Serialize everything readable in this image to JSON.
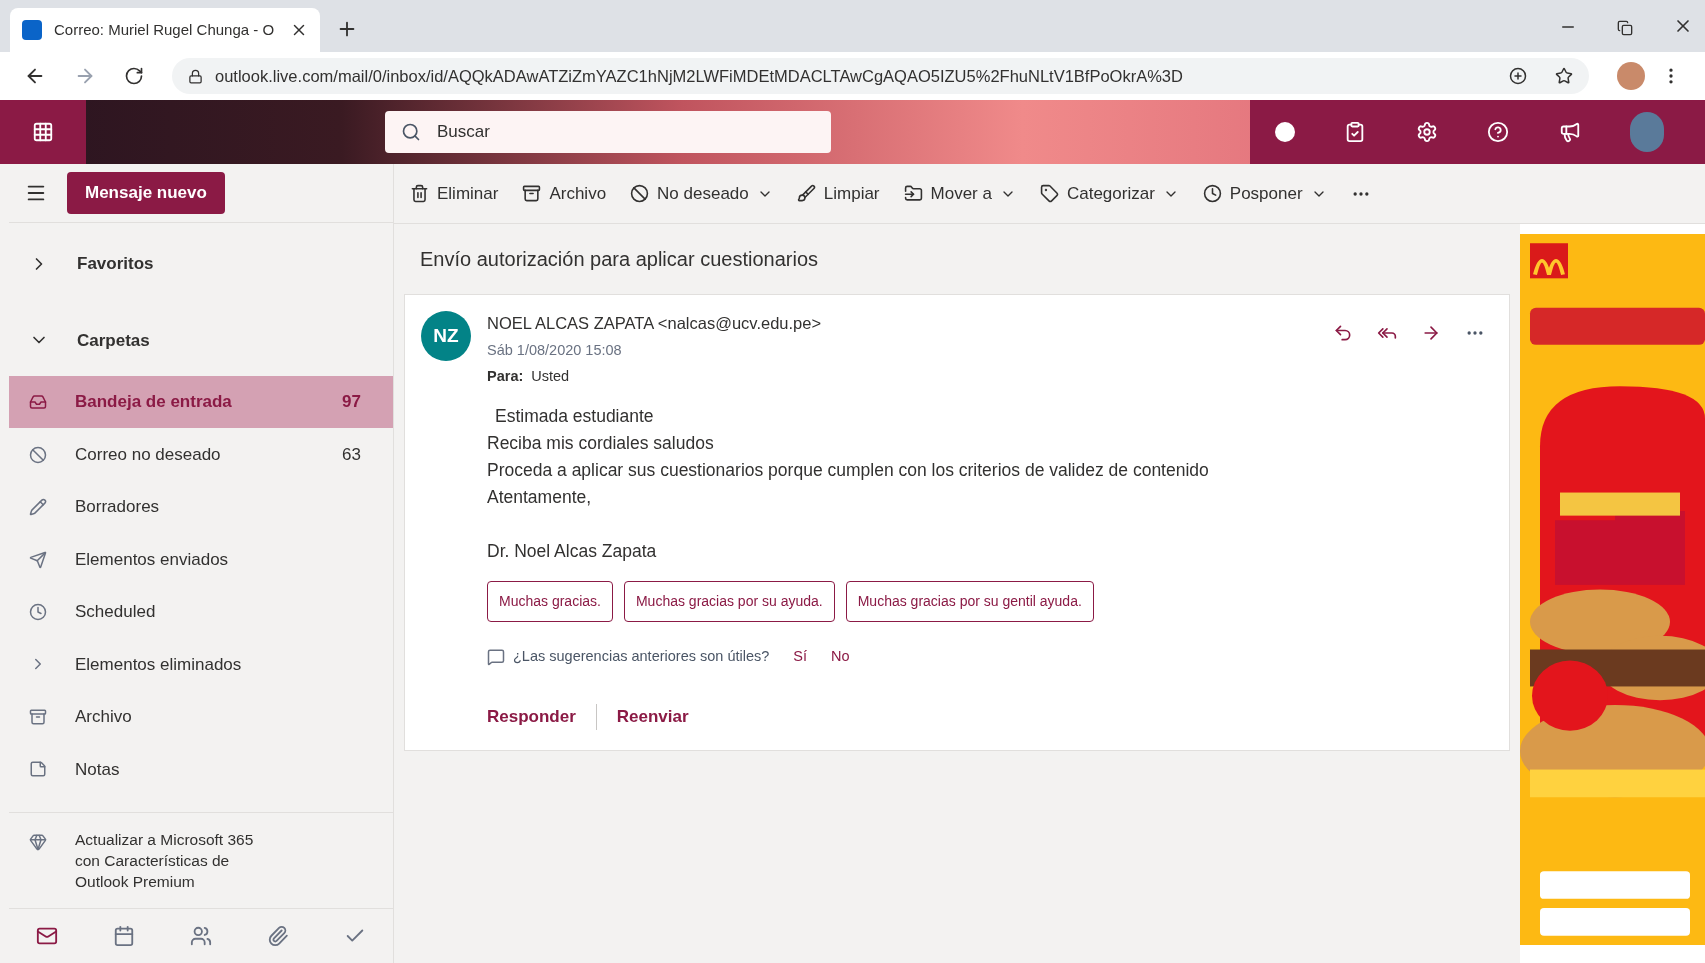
{
  "browser": {
    "tab_title": "Correo: Muriel Rugel Chunga - O",
    "url": "outlook.live.com/mail/0/inbox/id/AQQkADAwATZiZmYAZC1hNjM2LWFiMDEtMDACLTAwCgAQAO5IZU5%2FhuNLtV1BfPoOkrA%3D"
  },
  "header": {
    "search": {
      "placeholder": "Buscar"
    }
  },
  "new_message": "Mensaje nuevo",
  "toolbar": [
    {
      "label": "Eliminar",
      "dropdown": false
    },
    {
      "label": "Archivo",
      "dropdown": false
    },
    {
      "label": "No deseado",
      "dropdown": true
    },
    {
      "label": "Limpiar",
      "dropdown": false
    },
    {
      "label": "Mover a",
      "dropdown": true
    },
    {
      "label": "Categorizar",
      "dropdown": true
    },
    {
      "label": "Posponer",
      "dropdown": true
    }
  ],
  "sidebar": {
    "sections": [
      {
        "label": "Favoritos",
        "expanded": false
      },
      {
        "label": "Carpetas",
        "expanded": true
      }
    ],
    "folders": [
      {
        "label": "Bandeja de entrada",
        "count": "97",
        "selected": true
      },
      {
        "label": "Correo no deseado",
        "count": "63",
        "selected": false
      },
      {
        "label": "Borradores",
        "selected": false
      },
      {
        "label": "Elementos enviados",
        "selected": false
      },
      {
        "label": "Scheduled",
        "selected": false
      },
      {
        "label": "Elementos eliminados",
        "selected": false
      },
      {
        "label": "Archivo",
        "selected": false
      },
      {
        "label": "Notas",
        "selected": false
      }
    ],
    "upgrade": "Actualizar a Microsoft 365 con Características de Outlook Premium",
    "bottom_nav": [
      {
        "selected": true
      },
      {
        "selected": false
      },
      {
        "selected": false
      },
      {
        "selected": false
      },
      {
        "selected": false
      }
    ]
  },
  "message": {
    "subject": "Envío autorización para aplicar cuestionarios",
    "avatar": "NZ",
    "sender": "NOEL ALCAS ZAPATA <nalcas@ucv.edu.pe>",
    "date": "Sáb 1/08/2020 15:08",
    "to_label": "Para:",
    "to": "Usted",
    "body": [
      "Estimada estudiante",
      "Reciba mis cordiales saludos",
      "Proceda a aplicar sus cuestionarios porque cumplen con los criterios de validez de contenido",
      "Atentamente,"
    ],
    "signature": "Dr. Noel Alcas Zapata",
    "suggestions": [
      "Muchas gracias.",
      "Muchas gracias por su ayuda.",
      "Muchas gracias por su gentil ayuda."
    ],
    "feedback": {
      "question": "¿Las sugerencias anteriores son útiles?",
      "yes": "Sí",
      "no": "No"
    },
    "actions": [
      "Responder",
      "Reenviar"
    ]
  }
}
